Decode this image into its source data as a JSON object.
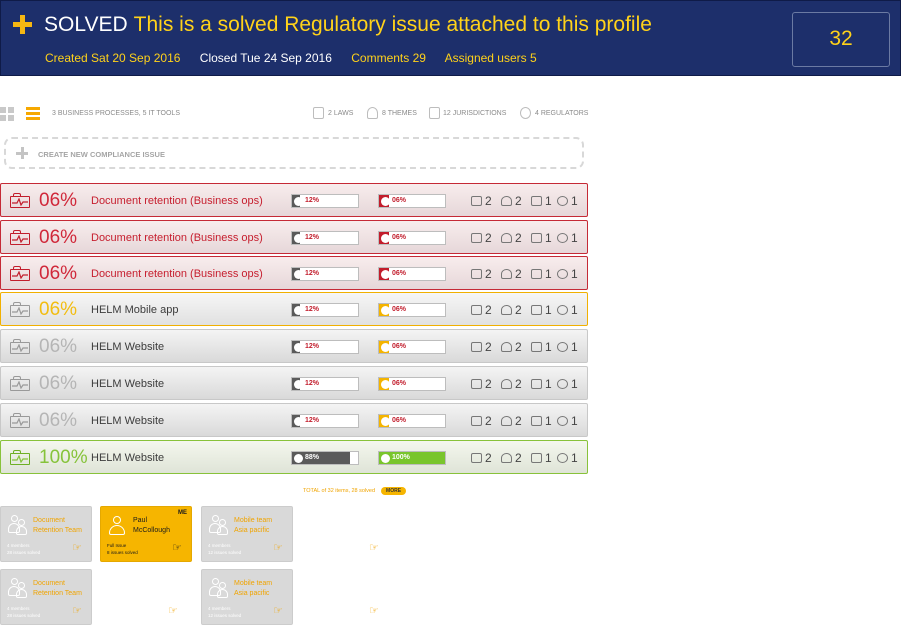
{
  "header": {
    "status": "SOLVED",
    "title": "This is a solved Regulatory issue attached to this profile",
    "created": "Created Sat 20 Sep 2016",
    "closed": "Closed Tue 24 Sep 2016",
    "comments": "Comments 29",
    "assigned": "Assigned users 5",
    "count": "32"
  },
  "toolbar": {
    "summary": "3 BUSINESS PROCESSES, 5 IT TOOLS",
    "laws": "2 LAWS",
    "themes": "8 THEMES",
    "jurisdictions": "12 JURISDICTIONS",
    "regulators": "4 REGULATORS"
  },
  "create_label": "CREATE NEW COMPLIANCE ISSUE",
  "rows": [
    {
      "status": "red",
      "pct": "06%",
      "name": "Document retention (Business ops)",
      "bar1": "12%",
      "bar1_fill": 0.12,
      "bar2": "06%",
      "bar2_fill": 0.06,
      "laws": "2",
      "themes": "2",
      "jur": "1",
      "reg": "1"
    },
    {
      "status": "red",
      "pct": "06%",
      "name": "Document retention (Business ops)",
      "bar1": "12%",
      "bar1_fill": 0.12,
      "bar2": "06%",
      "bar2_fill": 0.06,
      "laws": "2",
      "themes": "2",
      "jur": "1",
      "reg": "1"
    },
    {
      "status": "red",
      "pct": "06%",
      "name": "Document retention (Business ops)",
      "bar1": "12%",
      "bar1_fill": 0.12,
      "bar2": "06%",
      "bar2_fill": 0.06,
      "laws": "2",
      "themes": "2",
      "jur": "1",
      "reg": "1"
    },
    {
      "status": "orange",
      "pct": "06%",
      "name": "HELM Mobile app",
      "bar1": "12%",
      "bar1_fill": 0.12,
      "bar2": "06%",
      "bar2_fill": 0.06,
      "laws": "2",
      "themes": "2",
      "jur": "1",
      "reg": "1"
    },
    {
      "status": "grey",
      "pct": "06%",
      "name": "HELM Website",
      "bar1": "12%",
      "bar1_fill": 0.12,
      "bar2": "06%",
      "bar2_fill": 0.06,
      "laws": "2",
      "themes": "2",
      "jur": "1",
      "reg": "1"
    },
    {
      "status": "grey",
      "pct": "06%",
      "name": "HELM Website",
      "bar1": "12%",
      "bar1_fill": 0.12,
      "bar2": "06%",
      "bar2_fill": 0.06,
      "laws": "2",
      "themes": "2",
      "jur": "1",
      "reg": "1"
    },
    {
      "status": "grey",
      "pct": "06%",
      "name": "HELM Website",
      "bar1": "12%",
      "bar1_fill": 0.12,
      "bar2": "06%",
      "bar2_fill": 0.06,
      "laws": "2",
      "themes": "2",
      "jur": "1",
      "reg": "1"
    },
    {
      "status": "green",
      "pct": "100%",
      "name": "HELM Website",
      "bar1": "88%",
      "bar1_fill": 0.88,
      "bar2": "100%",
      "bar2_fill": 1.0,
      "laws": "2",
      "themes": "2",
      "jur": "1",
      "reg": "1"
    }
  ],
  "footer": {
    "total": "TOTAL of 32 items, 28 solved",
    "more": "MORE"
  },
  "teams": [
    {
      "name": [
        "Document",
        "Retention Team"
      ],
      "sub": [
        "4 members",
        "28 issues solved"
      ],
      "me": false
    },
    {
      "name": [
        "Paul",
        "McCollough"
      ],
      "sub": [
        "Full Issue",
        "8 issues solved"
      ],
      "me": true,
      "me_label": "ME"
    },
    {
      "name": [
        "Mobile team",
        "Asia pacific"
      ],
      "sub": [
        "4 members",
        "12 issues solved"
      ],
      "me": false
    },
    {
      "name": [
        "Document",
        "Retention Team"
      ],
      "sub": [
        "4 members",
        "28 issues solved"
      ],
      "me": false
    },
    {
      "name": [
        "Mobile team",
        "Asia pacific"
      ],
      "sub": [
        "4 members",
        "12 issues solved"
      ],
      "me": false
    }
  ],
  "colors": {
    "header_bg": "#1d2f6b",
    "accent_yellow": "#ffd21a",
    "red": "#c21d2c",
    "orange": "#f2bd12",
    "green": "#86c33a"
  }
}
